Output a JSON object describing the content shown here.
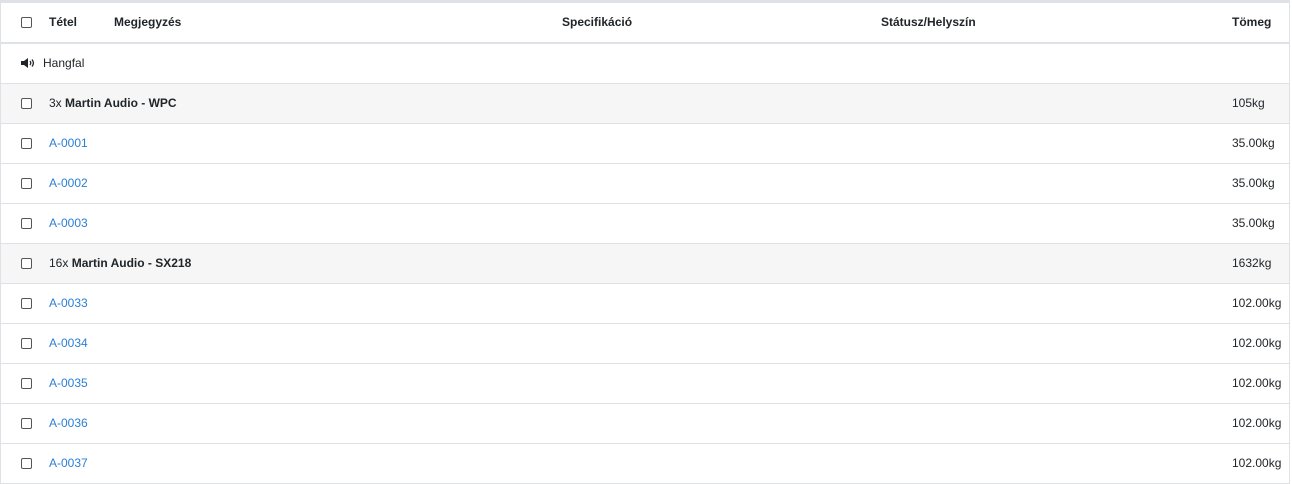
{
  "columns": {
    "item": "Tétel",
    "note": "Megjegyzés",
    "spec": "Specifikáció",
    "status": "Státusz/Helyszín",
    "weight": "Tömeg"
  },
  "category": {
    "icon": "speaker-icon",
    "label": "Hangfal"
  },
  "groups": [
    {
      "qty": "3x",
      "name": "Martin Audio - WPC",
      "weight": "105kg",
      "items": [
        {
          "code": "A-0001",
          "weight": "35.00kg"
        },
        {
          "code": "A-0002",
          "weight": "35.00kg"
        },
        {
          "code": "A-0003",
          "weight": "35.00kg"
        }
      ]
    },
    {
      "qty": "16x",
      "name": "Martin Audio - SX218",
      "weight": "1632kg",
      "items": [
        {
          "code": "A-0033",
          "weight": "102.00kg"
        },
        {
          "code": "A-0034",
          "weight": "102.00kg"
        },
        {
          "code": "A-0035",
          "weight": "102.00kg"
        },
        {
          "code": "A-0036",
          "weight": "102.00kg"
        },
        {
          "code": "A-0037",
          "weight": "102.00kg"
        }
      ]
    }
  ],
  "colors": {
    "link": "#2a7fd4",
    "border": "#dee2e6",
    "group_bg": "#f6f6f6"
  }
}
